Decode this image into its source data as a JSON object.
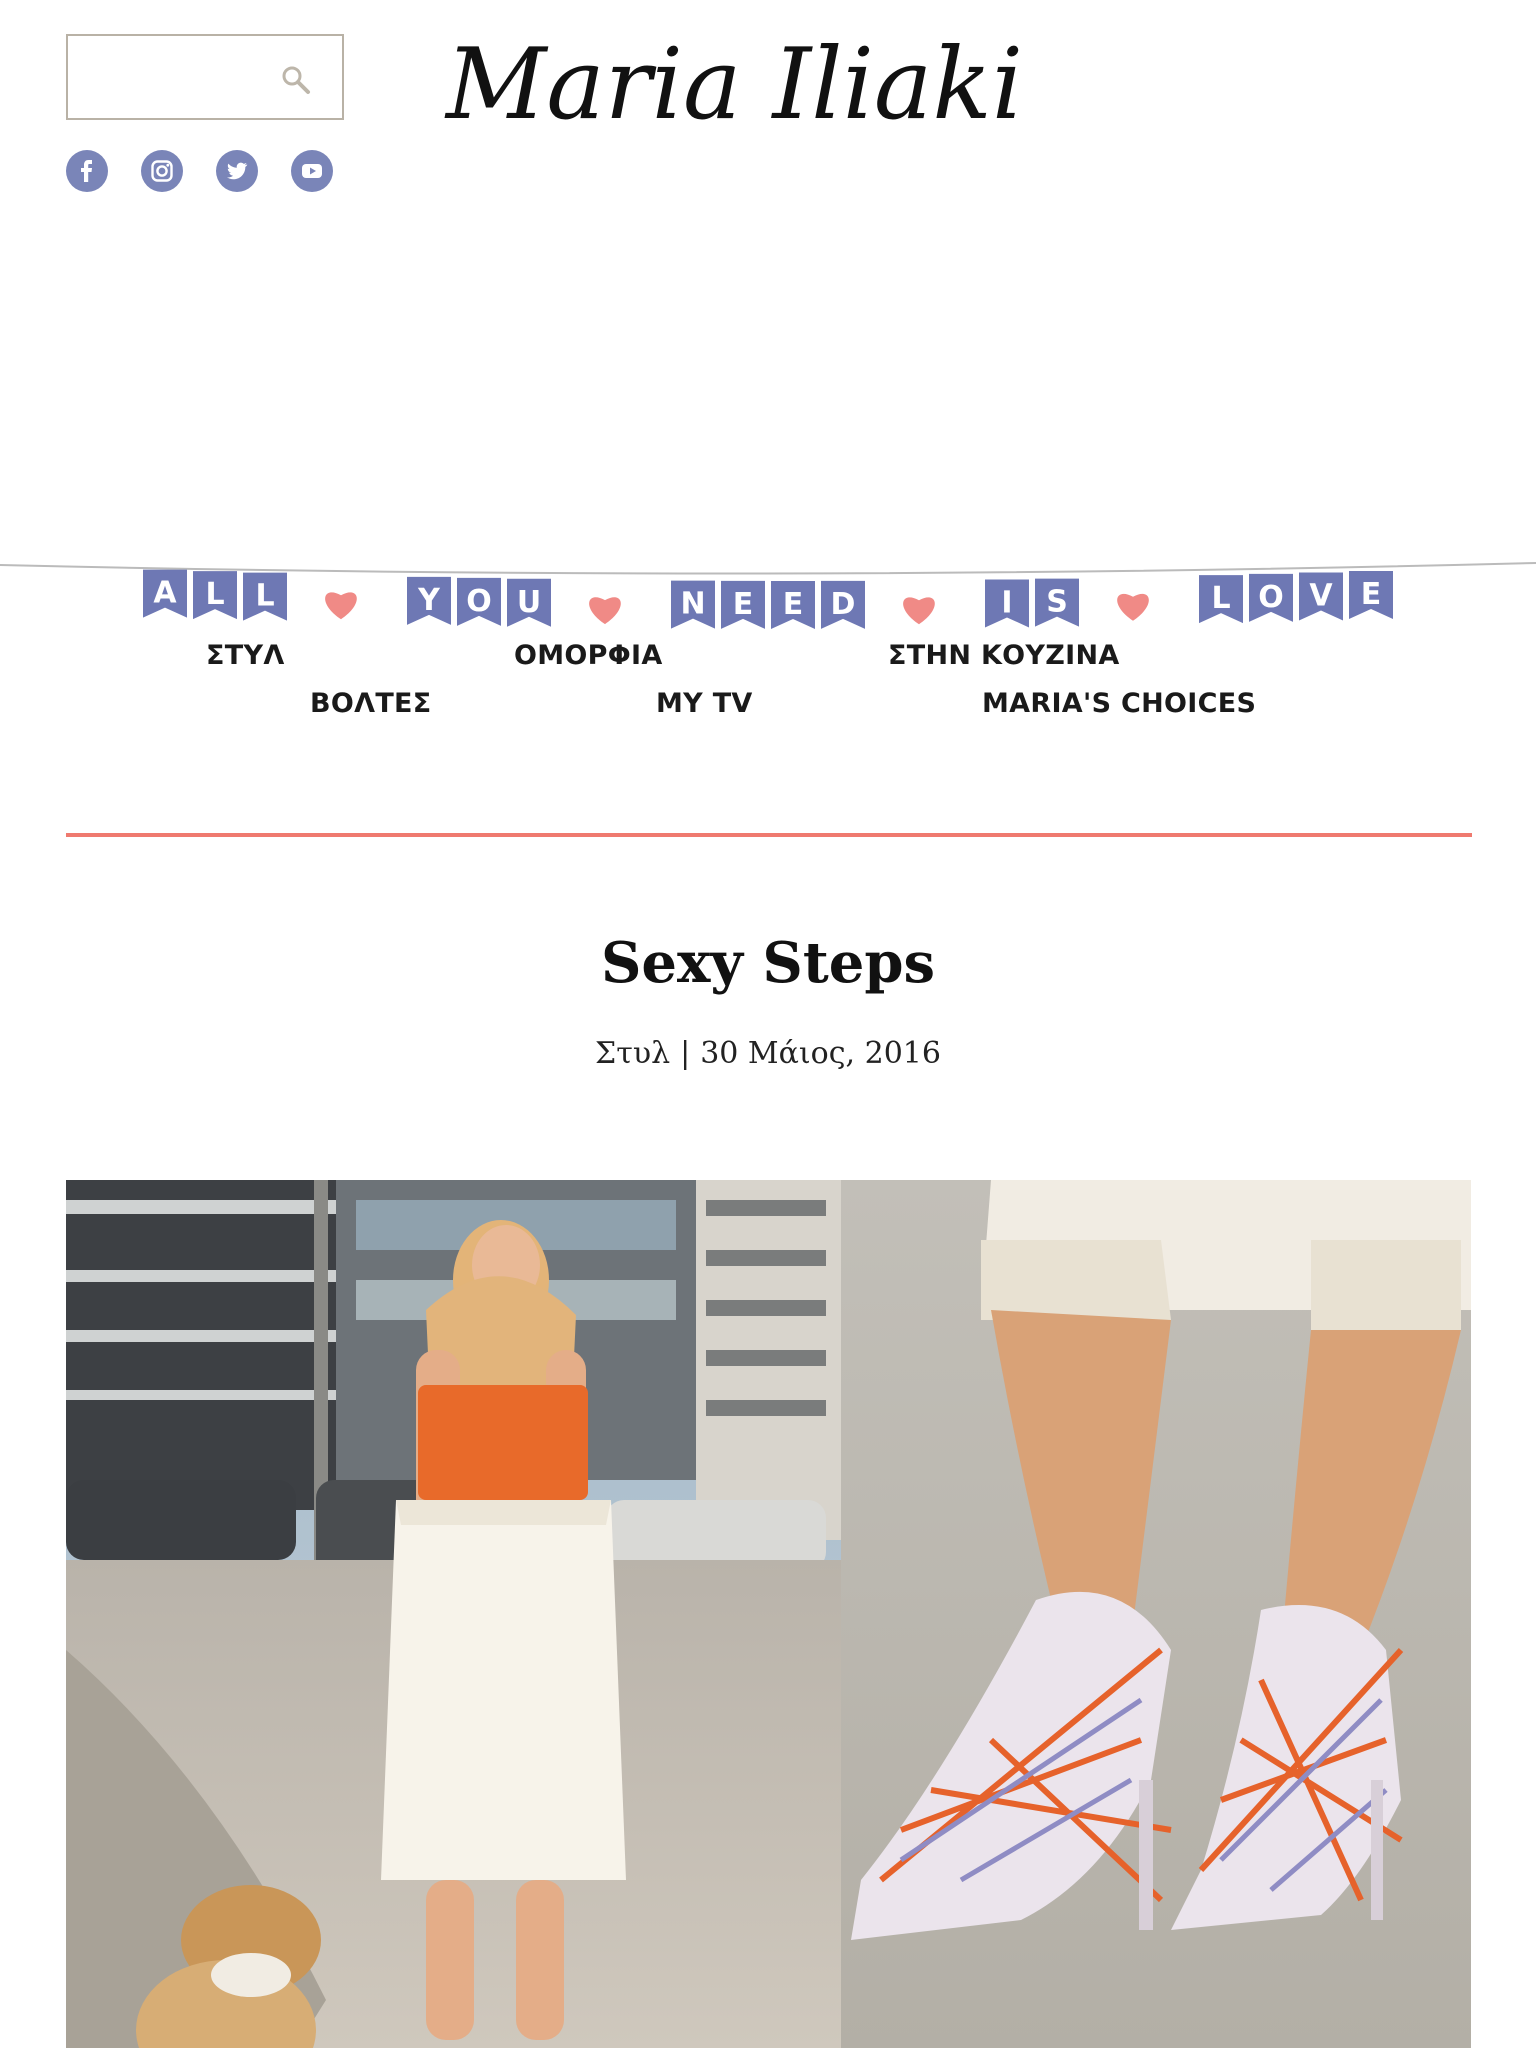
{
  "header": {
    "logo_text": "Maria Iliaki",
    "search": {
      "value": "",
      "placeholder": ""
    },
    "social": [
      "facebook-icon",
      "instagram-icon",
      "twitter-icon",
      "youtube-icon"
    ]
  },
  "banner": {
    "words": [
      "ALL",
      "YOU",
      "NEED",
      "IS",
      "LOVE"
    ],
    "flag_color": "#6e78b4",
    "heart_color": "#f08a86"
  },
  "nav": {
    "items": [
      "ΣΤΥΛ",
      "ΒΟΛΤΕΣ",
      "ΟΜΟΡΦΙΑ",
      "MY TV",
      "ΣΤΗΝ ΚΟΥΖΙΝΑ",
      "MARIA'S CHOICES"
    ]
  },
  "accent_color": "#ef7a6f",
  "post": {
    "title": "Sexy Steps",
    "category": "Στυλ",
    "separator": "|",
    "date": "30 Μάιος, 2016"
  }
}
